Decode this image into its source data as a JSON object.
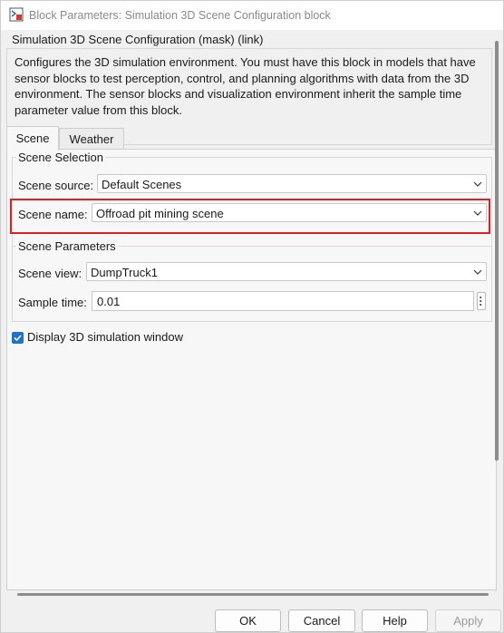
{
  "window": {
    "title": "Block Parameters: Simulation 3D Scene Configuration block"
  },
  "mask": {
    "title": "Simulation 3D Scene Configuration (mask) (link)",
    "description": "Configures the 3D simulation environment. You must have this block in models that have sensor blocks to test perception, control, and planning algorithms with data from the 3D environment. The sensor blocks and visualization environment inherit the sample time parameter value from this block."
  },
  "tabs": [
    {
      "label": "Scene",
      "active": true
    },
    {
      "label": "Weather",
      "active": false
    }
  ],
  "scene_selection": {
    "group_label": "Scene Selection",
    "source_label": "Scene source:",
    "source_value": "Default Scenes",
    "name_label": "Scene name:",
    "name_value": "Offroad pit mining scene"
  },
  "scene_parameters": {
    "group_label": "Scene Parameters",
    "view_label": "Scene view:",
    "view_value": "DumpTruck1",
    "sample_time_label": "Sample time:",
    "sample_time_value": "0.01"
  },
  "display_window": {
    "label": "Display 3D simulation window",
    "checked": true
  },
  "buttons": {
    "ok": "OK",
    "cancel": "Cancel",
    "help": "Help",
    "apply": "Apply"
  },
  "colors": {
    "highlight": "#e02020",
    "checkbox_accent": "#1e73c9"
  },
  "icons": {
    "window_icon": "simulink-block-icon",
    "dropdown": "chevron-down-icon",
    "checkmark": "checkmark-icon",
    "more": "vertical-ellipsis-icon"
  }
}
